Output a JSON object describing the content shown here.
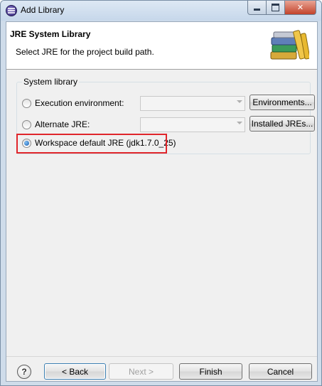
{
  "window": {
    "title": "Add Library",
    "controls": {
      "minimize_icon": "minimize-icon",
      "maximize_icon": "maximize-icon",
      "close_label": "✕"
    }
  },
  "header": {
    "title": "JRE System Library",
    "description": "Select JRE for the project build path.",
    "icon": "library-books-icon"
  },
  "system_library": {
    "legend": "System library",
    "options": [
      {
        "label": "Execution environment:",
        "selected": false,
        "combo_value": "",
        "button_label": "Environments..."
      },
      {
        "label": "Alternate JRE:",
        "selected": false,
        "combo_value": "",
        "button_label": "Installed JREs..."
      },
      {
        "label": "Workspace default JRE (jdk1.7.0_25)",
        "selected": true
      }
    ]
  },
  "footer": {
    "help_label": "?",
    "back_label": "< Back",
    "next_label": "Next >",
    "finish_label": "Finish",
    "cancel_label": "Cancel"
  },
  "colors": {
    "highlight_border": "#e0262b",
    "title_bar": "#cfdcea"
  }
}
